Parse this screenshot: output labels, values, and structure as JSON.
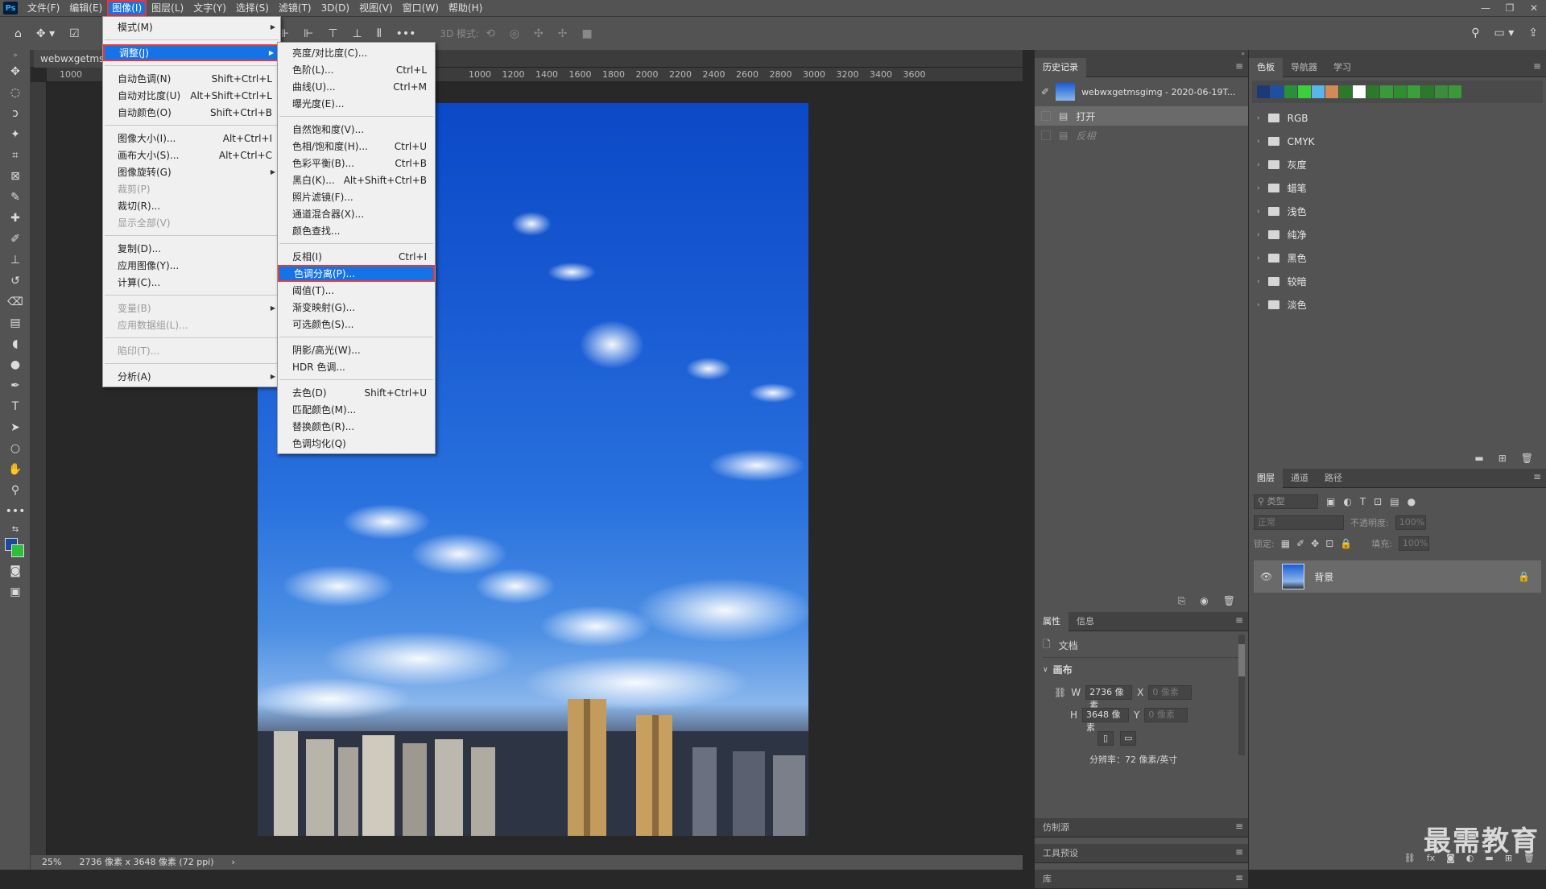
{
  "menubar": {
    "items": [
      "文件(F)",
      "编辑(E)",
      "图像(I)",
      "图层(L)",
      "文字(Y)",
      "选择(S)",
      "滤镜(T)",
      "3D(D)",
      "视图(V)",
      "窗口(W)",
      "帮助(H)"
    ],
    "active_index": 2
  },
  "optionbar": {
    "mode3d_label": "3D 模式:"
  },
  "document": {
    "tab_title": "webwxgetmsgimg",
    "ruler_ticks": [
      "1000",
      "1200",
      "1400",
      "1600",
      "1800",
      "2000",
      "2200",
      "2400",
      "2600",
      "2800",
      "3000",
      "3200",
      "3400",
      "3600"
    ],
    "ruler_ticks_left": [
      "1000"
    ],
    "zoom": "25%",
    "doc_info": "2736 像素 x 3648 像素 (72 ppi)"
  },
  "image_menu": [
    {
      "label": "模式(M)",
      "shortcut": "",
      "submenu": true
    },
    {
      "sep": true
    },
    {
      "label": "调整(J)",
      "shortcut": "",
      "submenu": true,
      "highlight": true,
      "redbox": true
    },
    {
      "sep": true
    },
    {
      "label": "自动色调(N)",
      "shortcut": "Shift+Ctrl+L"
    },
    {
      "label": "自动对比度(U)",
      "shortcut": "Alt+Shift+Ctrl+L"
    },
    {
      "label": "自动颜色(O)",
      "shortcut": "Shift+Ctrl+B"
    },
    {
      "sep": true
    },
    {
      "label": "图像大小(I)...",
      "shortcut": "Alt+Ctrl+I"
    },
    {
      "label": "画布大小(S)...",
      "shortcut": "Alt+Ctrl+C"
    },
    {
      "label": "图像旋转(G)",
      "shortcut": "",
      "submenu": true
    },
    {
      "label": "裁剪(P)",
      "shortcut": "",
      "disabled": true
    },
    {
      "label": "裁切(R)...",
      "shortcut": ""
    },
    {
      "label": "显示全部(V)",
      "shortcut": "",
      "disabled": true
    },
    {
      "sep": true
    },
    {
      "label": "复制(D)...",
      "shortcut": ""
    },
    {
      "label": "应用图像(Y)...",
      "shortcut": ""
    },
    {
      "label": "计算(C)...",
      "shortcut": ""
    },
    {
      "sep": true
    },
    {
      "label": "变量(B)",
      "shortcut": "",
      "submenu": true,
      "disabled": true
    },
    {
      "label": "应用数据组(L)...",
      "shortcut": "",
      "disabled": true
    },
    {
      "sep": true
    },
    {
      "label": "陷印(T)...",
      "shortcut": "",
      "disabled": true
    },
    {
      "sep": true
    },
    {
      "label": "分析(A)",
      "shortcut": "",
      "submenu": true
    }
  ],
  "adjust_menu": [
    {
      "label": "亮度/对比度(C)...",
      "shortcut": ""
    },
    {
      "label": "色阶(L)...",
      "shortcut": "Ctrl+L"
    },
    {
      "label": "曲线(U)...",
      "shortcut": "Ctrl+M"
    },
    {
      "label": "曝光度(E)...",
      "shortcut": ""
    },
    {
      "sep": true
    },
    {
      "label": "自然饱和度(V)...",
      "shortcut": ""
    },
    {
      "label": "色相/饱和度(H)...",
      "shortcut": "Ctrl+U"
    },
    {
      "label": "色彩平衡(B)...",
      "shortcut": "Ctrl+B"
    },
    {
      "label": "黑白(K)...",
      "shortcut": "Alt+Shift+Ctrl+B"
    },
    {
      "label": "照片滤镜(F)...",
      "shortcut": ""
    },
    {
      "label": "通道混合器(X)...",
      "shortcut": ""
    },
    {
      "label": "颜色查找...",
      "shortcut": ""
    },
    {
      "sep": true
    },
    {
      "label": "反相(I)",
      "shortcut": "Ctrl+I"
    },
    {
      "label": "色调分离(P)...",
      "shortcut": "",
      "highlight": true,
      "redbox": true
    },
    {
      "label": "阈值(T)...",
      "shortcut": ""
    },
    {
      "label": "渐变映射(G)...",
      "shortcut": ""
    },
    {
      "label": "可选颜色(S)...",
      "shortcut": ""
    },
    {
      "sep": true
    },
    {
      "label": "阴影/高光(W)...",
      "shortcut": ""
    },
    {
      "label": "HDR 色调...",
      "shortcut": ""
    },
    {
      "sep": true
    },
    {
      "label": "去色(D)",
      "shortcut": "Shift+Ctrl+U"
    },
    {
      "label": "匹配颜色(M)...",
      "shortcut": ""
    },
    {
      "label": "替换颜色(R)...",
      "shortcut": ""
    },
    {
      "label": "色调均化(Q)",
      "shortcut": ""
    }
  ],
  "history_panel": {
    "tab": "历史记录",
    "snapshot": "webwxgetmsgimg - 2020-06-19T...",
    "steps": [
      {
        "label": "打开",
        "active": true
      },
      {
        "label": "反相",
        "active": false
      }
    ]
  },
  "swatches_panel": {
    "tabs": [
      "色板",
      "导航器",
      "学习"
    ],
    "colors": [
      "#1a3a7a",
      "#1f4fa3",
      "#2a8f3a",
      "#3ccf3c",
      "#5ab6e8",
      "#d28a5a",
      "#2a7a2a",
      "#ffffff",
      "#2a7a2a",
      "#3a9a3a",
      "#2f8f2f",
      "#3aa03a",
      "#2a7a2a",
      "#3c8c3c",
      "#3a9a3a"
    ],
    "groups": [
      "RGB",
      "CMYK",
      "灰度",
      "蜡笔",
      "浅色",
      "纯净",
      "黑色",
      "较暗",
      "淡色"
    ]
  },
  "properties_panel": {
    "tabs": [
      "属性",
      "信息"
    ],
    "doc_label": "文档",
    "section": "画布",
    "w_label": "W",
    "w_value": "2736 像素",
    "h_label": "H",
    "h_value": "3648 像素",
    "x_label": "X",
    "x_value": "0 像素",
    "y_label": "Y",
    "y_value": "0 像素",
    "resolution": "分辨率：72 像素/英寸"
  },
  "collapsed_panels": [
    "仿制源",
    "工具预设",
    "库"
  ],
  "layers_panel": {
    "tabs": [
      "图层",
      "通道",
      "路径"
    ],
    "filter_placeholder": "类型",
    "blend_mode": "正常",
    "opacity_label": "不透明度:",
    "opacity_value": "100%",
    "lock_label": "锁定:",
    "fill_label": "填充:",
    "fill_value": "100%",
    "layer_name": "背景"
  },
  "watermark": "最需教育"
}
